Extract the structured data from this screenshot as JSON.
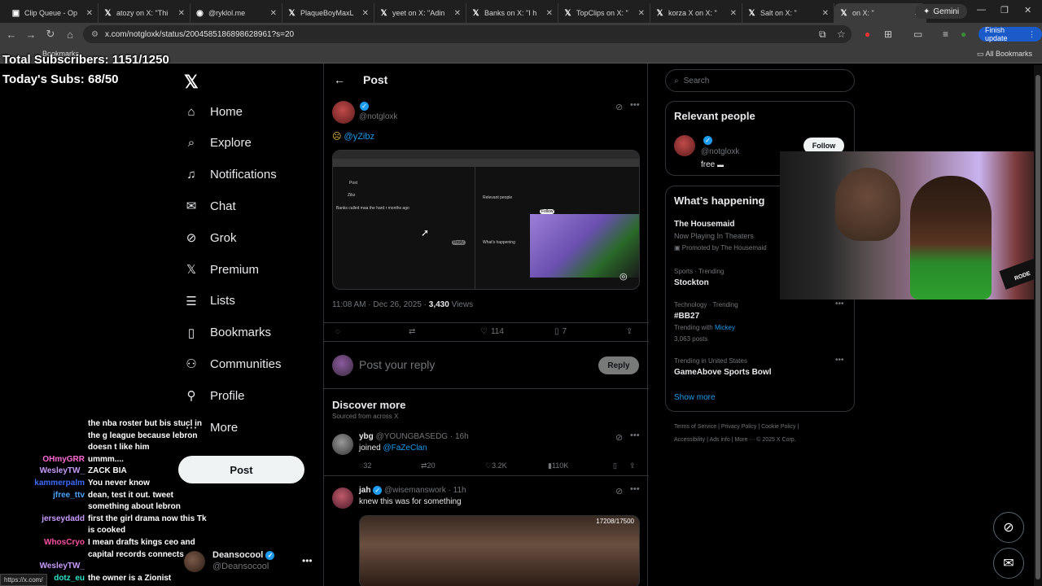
{
  "browser": {
    "tabs": [
      {
        "label": "Clip Queue - Op",
        "icon": "twitch-icon"
      },
      {
        "label": "atozy on X: \"Thi",
        "icon": "x-icon"
      },
      {
        "label": "@ryklol.me",
        "icon": "profile-icon"
      },
      {
        "label": "PlaqueBoyMaxL",
        "icon": "x-icon"
      },
      {
        "label": "yeet on X: \"Adin",
        "icon": "x-icon"
      },
      {
        "label": "Banks on X: \"I h",
        "icon": "x-icon"
      },
      {
        "label": "TopClips on X: \"",
        "icon": "x-icon"
      },
      {
        "label": "korza X on X: \"",
        "icon": "x-icon"
      },
      {
        "label": "Salt on X: \"",
        "icon": "x-icon"
      },
      {
        "label": "on X: \"",
        "icon": "x-icon"
      }
    ],
    "gemini_label": "Gemini",
    "url": "x.com/notgloxk/status/2004585186898628961?s=20",
    "finish_update": "Finish update",
    "bookmarks_label": "Bookmarks",
    "all_bookmarks": "All Bookmarks",
    "status_url": "https://x.com/"
  },
  "overlay": {
    "total_subs": "Total Subscribers: 1151/1250",
    "today_subs": "Today's Subs: 68/50"
  },
  "nav": {
    "items": [
      {
        "label": "Home",
        "icon": "home-icon"
      },
      {
        "label": "Explore",
        "icon": "search-icon"
      },
      {
        "label": "Notifications",
        "icon": "bell-icon"
      },
      {
        "label": "Chat",
        "icon": "mail-icon"
      },
      {
        "label": "Grok",
        "icon": "grok-icon"
      },
      {
        "label": "Premium",
        "icon": "x-icon"
      },
      {
        "label": "Lists",
        "icon": "list-icon"
      },
      {
        "label": "Bookmarks",
        "icon": "bookmark-icon"
      },
      {
        "label": "Communities",
        "icon": "people-icon"
      },
      {
        "label": "Profile",
        "icon": "person-icon"
      },
      {
        "label": "More",
        "icon": "more-icon"
      }
    ],
    "post_button": "Post",
    "account": {
      "name": "Deansocool",
      "handle": "@Deansocool"
    }
  },
  "chat": [
    {
      "user": "",
      "color": "#ffffff",
      "msg": "the nba roster but bis stucl in"
    },
    {
      "user": "",
      "color": "#ffffff",
      "msg": "the g league because lebron"
    },
    {
      "user": "",
      "color": "#ffffff",
      "msg": "doesn t like him"
    },
    {
      "user": "OHmyGRR",
      "color": "#ff6ad5",
      "msg": "ummm...."
    },
    {
      "user": "WesleyTW_",
      "color": "#c89bff",
      "msg": "ZACK BIA"
    },
    {
      "user": "kammerpalm",
      "color": "#3c6bff",
      "msg": "You never know"
    },
    {
      "user": "jfree_ttv",
      "color": "#4aa3ff",
      "msg": "dean, test it out. tweet"
    },
    {
      "user": "",
      "color": "#ffffff",
      "msg": "something about lebron"
    },
    {
      "user": "jerseydadd",
      "color": "#c89bff",
      "msg": "first the girl drama now this Tk"
    },
    {
      "user": "",
      "color": "#ffffff",
      "msg": "is cooked"
    },
    {
      "user": "WhosCryo",
      "color": "#ff4fa3",
      "msg": "I mean drafts kings ceo and"
    },
    {
      "user": "",
      "color": "#ffffff",
      "msg": "capital records connects"
    },
    {
      "user": "WesleyTW_",
      "color": "#c89bff",
      "msg": ""
    },
    {
      "user": "dotz_eu",
      "color": "#2fe3c9",
      "msg": "the owner is a Zionist"
    }
  ],
  "post": {
    "header": "Post",
    "handle": "@notgloxk",
    "text": "@yZibz",
    "time": "11:08 AM · Dec 26, 2025 ·",
    "views_count": "3,430",
    "views_label": "Views",
    "likes": "114",
    "bookmarks": "7",
    "reply_placeholder": "Post your reply",
    "reply_button": "Reply",
    "media_texts": {
      "post": "Post",
      "name": "Zibz",
      "tweet": "Banks called maa the hard r months ago",
      "relevant": "Relevant people",
      "follow": "Follow",
      "whats": "What's happening",
      "reply": "Reply"
    }
  },
  "discover": {
    "title": "Discover more",
    "subtitle": "Sourced from across X",
    "tweets": [
      {
        "name": "ybg",
        "handle": "@YOUNGBASEDG",
        "time": "· 16h",
        "text": "joined",
        "mention": "@FaZeClan",
        "replies": "32",
        "retweets": "20",
        "likes": "3.2K",
        "views": "110K"
      },
      {
        "name": "jah",
        "handle": "@wisemanswork",
        "time": "· 11h",
        "text": "knew this was for something",
        "video_counter": "17208/17500"
      }
    ]
  },
  "right": {
    "search_placeholder": "Search",
    "relevant_title": "Relevant people",
    "relevant_handle": "@notgloxk",
    "relevant_bio": "free",
    "follow": "Follow",
    "happening_title": "What’s happening",
    "trends": [
      {
        "title": "The Housemaid",
        "line1": "Now Playing In Theaters",
        "line2": "Promoted by The Housemaid"
      },
      {
        "meta": "Sports · Trending",
        "title": "Stockton"
      },
      {
        "meta": "Technology · Trending",
        "title": "#BB27",
        "with_label": "Trending with",
        "with_link": "Mickey",
        "posts": "3,063 posts"
      },
      {
        "meta": "Trending in United States",
        "title": "GameAbove Sports Bowl"
      }
    ],
    "show_more": "Show more",
    "footer1": "Terms of Service  |  Privacy Policy  |  Cookie Policy  |",
    "footer2": "Accessibility  |  Ads info  |  More ···  © 2025 X Corp."
  },
  "webcam": {
    "mic_label": "RODE"
  }
}
